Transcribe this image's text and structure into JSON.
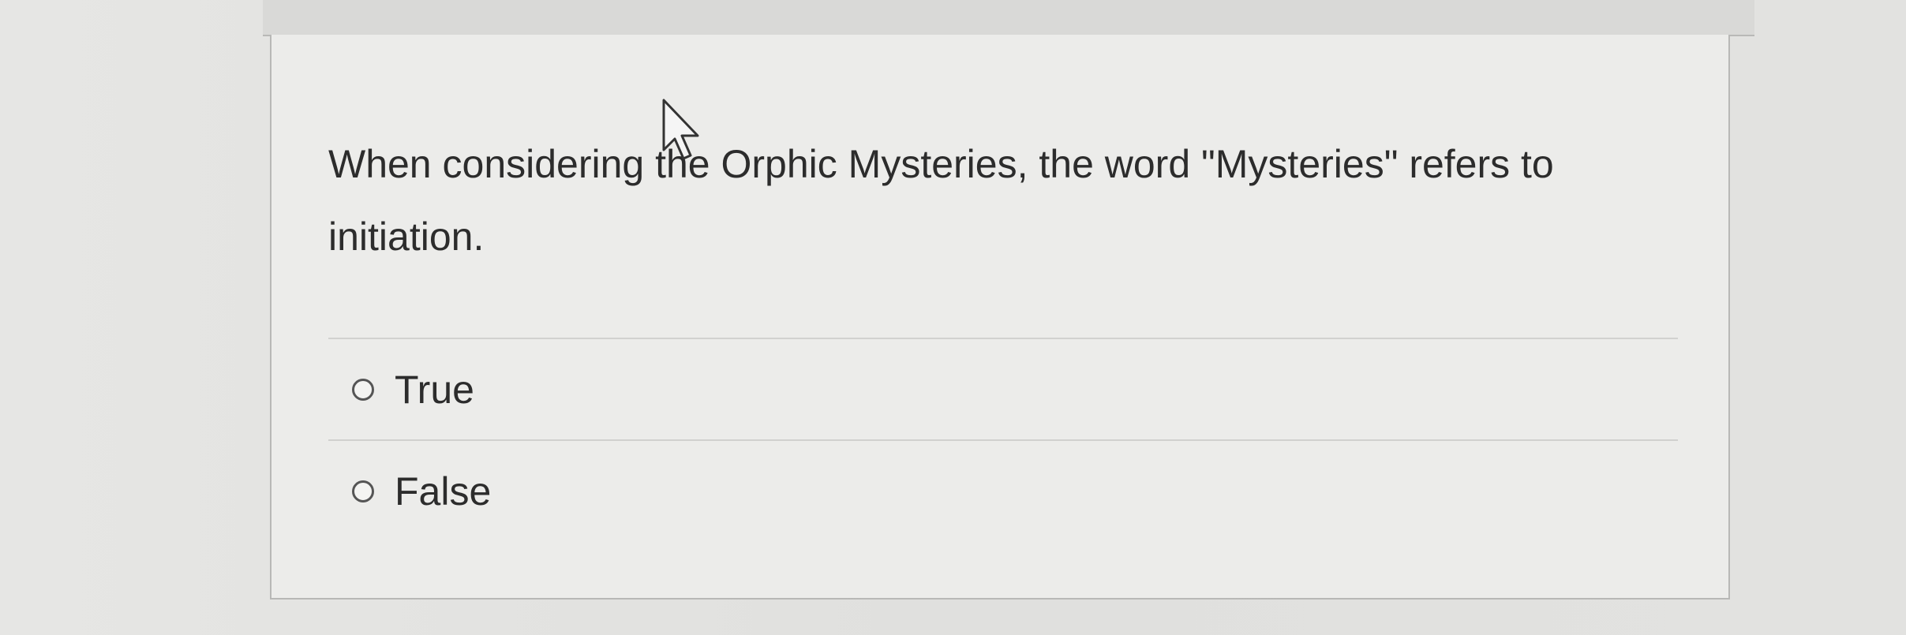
{
  "question": {
    "text": "When considering the Orphic Mysteries, the word \"Mysteries\" refers to initiation."
  },
  "answers": [
    {
      "label": "True",
      "selected": false
    },
    {
      "label": "False",
      "selected": false
    }
  ],
  "colors": {
    "background": "#e3e3e1",
    "card": "#ececea",
    "text": "#2c2c2c",
    "border": "#b8b8b6"
  }
}
